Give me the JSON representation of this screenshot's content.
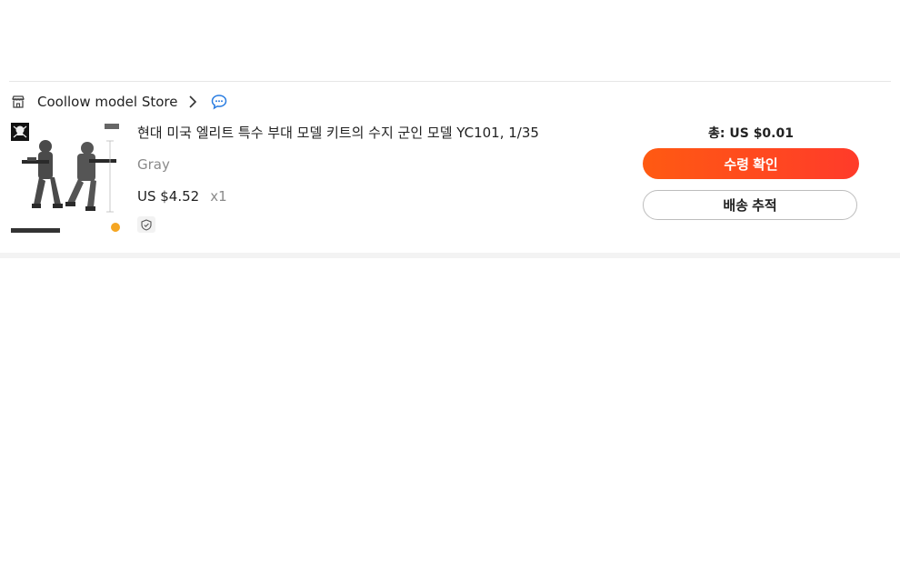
{
  "store": {
    "name": "Coollow model Store",
    "icons": {
      "store": "store-icon",
      "chevron": "chevron-right-icon",
      "chat": "chat-bubble-icon"
    }
  },
  "item": {
    "title": "현대 미국 엘리트 특수 부대 모델 키트의 수지 군인 모델 YC101, 1/35",
    "variant": "Gray",
    "price": "US $4.52",
    "quantity": "x1",
    "badge_icon": "shield-check-icon",
    "image_icon": "product-thumbnail"
  },
  "order": {
    "total": "총: US $0.01",
    "confirm_label": "수령 확인",
    "track_label": "배송 추적"
  },
  "colors": {
    "accent": "#ff4d1a",
    "chat": "#2a7de1"
  }
}
